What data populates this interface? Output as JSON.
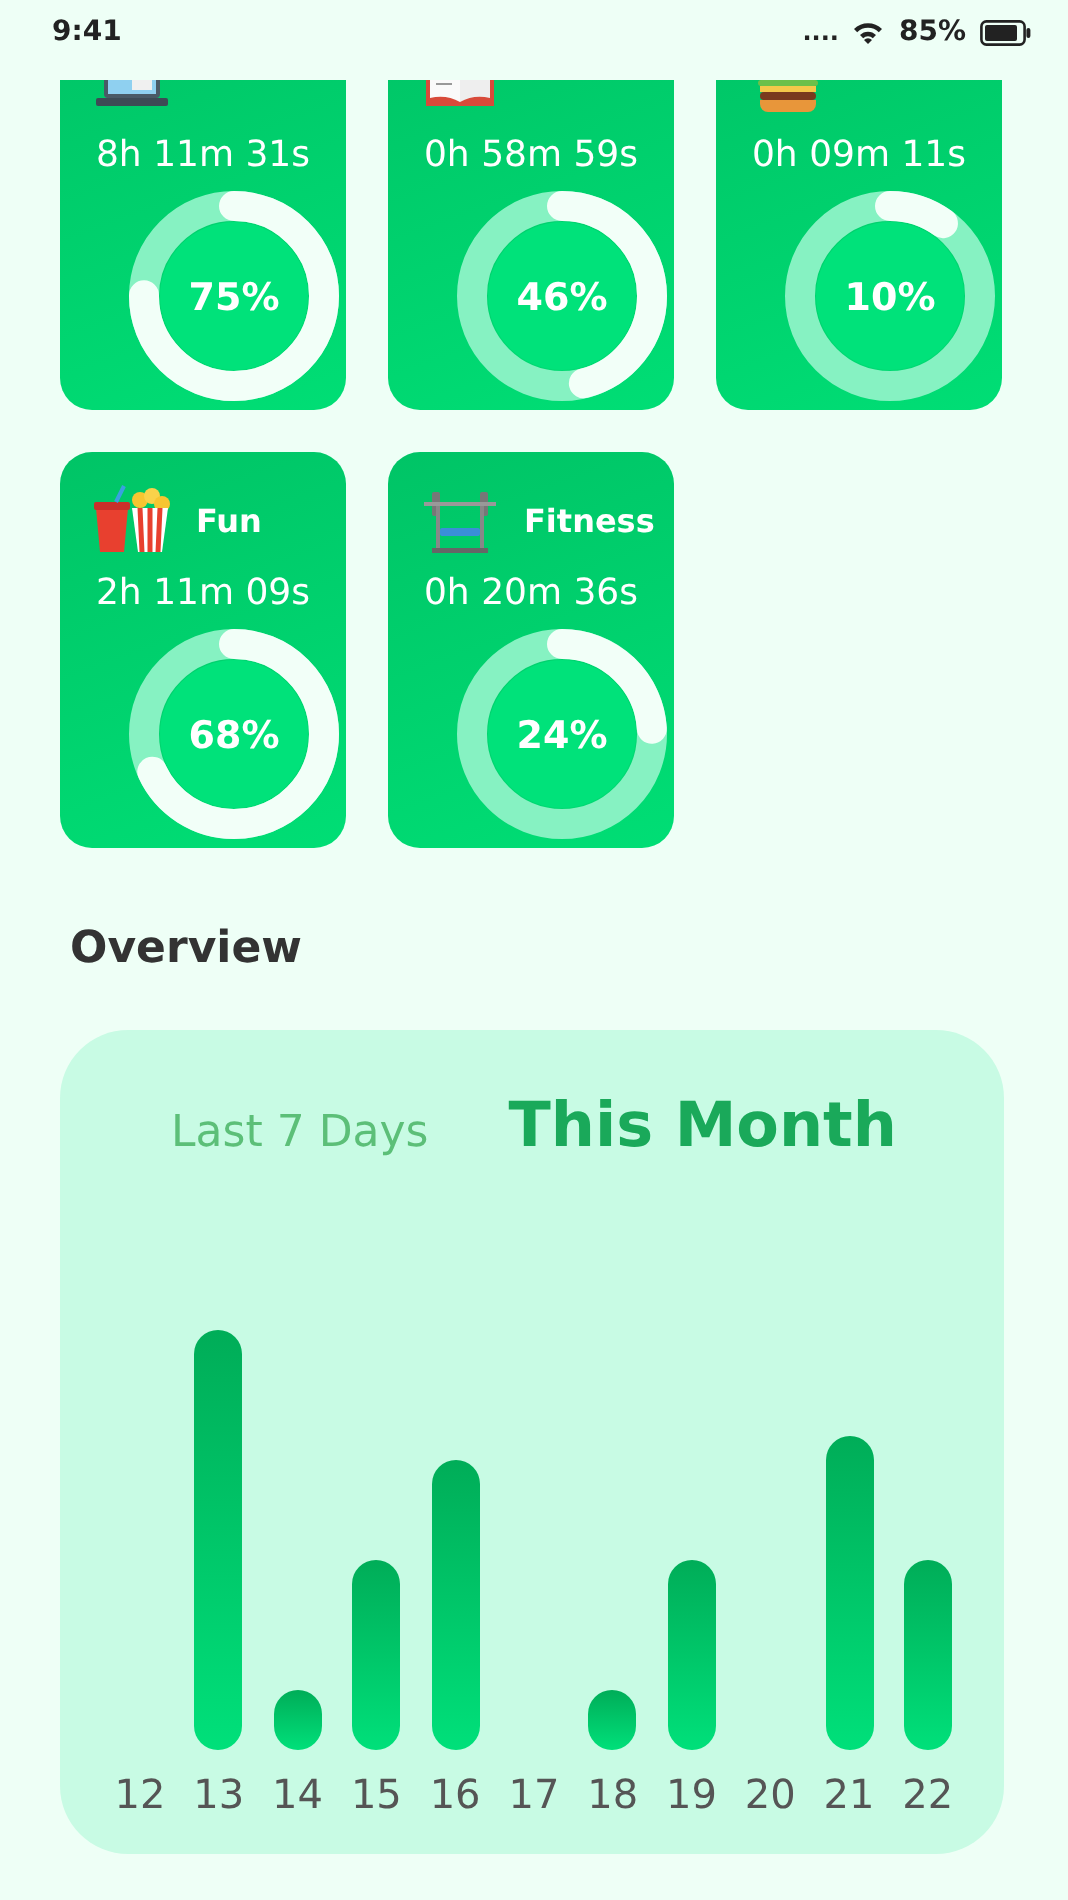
{
  "status_bar": {
    "time": "9:41",
    "signal": "....",
    "battery": "85%"
  },
  "activities": [
    {
      "duration": "8h 11m 31s",
      "level": 0.75,
      "percent": "75%"
    },
    {
      "duration": "0h 58m 59s",
      "level": 0.46,
      "percent": "46%"
    },
    {
      "duration": "0h 09m 11s",
      "level": 0.1,
      "percent": "10%"
    },
    {
      "title": "Fun",
      "duration": "2h 11m 09s",
      "level": 0.68,
      "percent": "68%"
    },
    {
      "title": "Fitness",
      "duration": "0h 20m 36s",
      "level": 0.24,
      "percent": "24%"
    }
  ],
  "overview": {
    "title": "Overview",
    "tabs": [
      {
        "label": "Last 7 Days",
        "selected": false
      },
      {
        "label": "This Month",
        "selected": true
      }
    ],
    "days": [
      "12",
      "13",
      "14",
      "15",
      "16",
      "17",
      "18",
      "19",
      "20",
      "21",
      "22"
    ]
  }
}
